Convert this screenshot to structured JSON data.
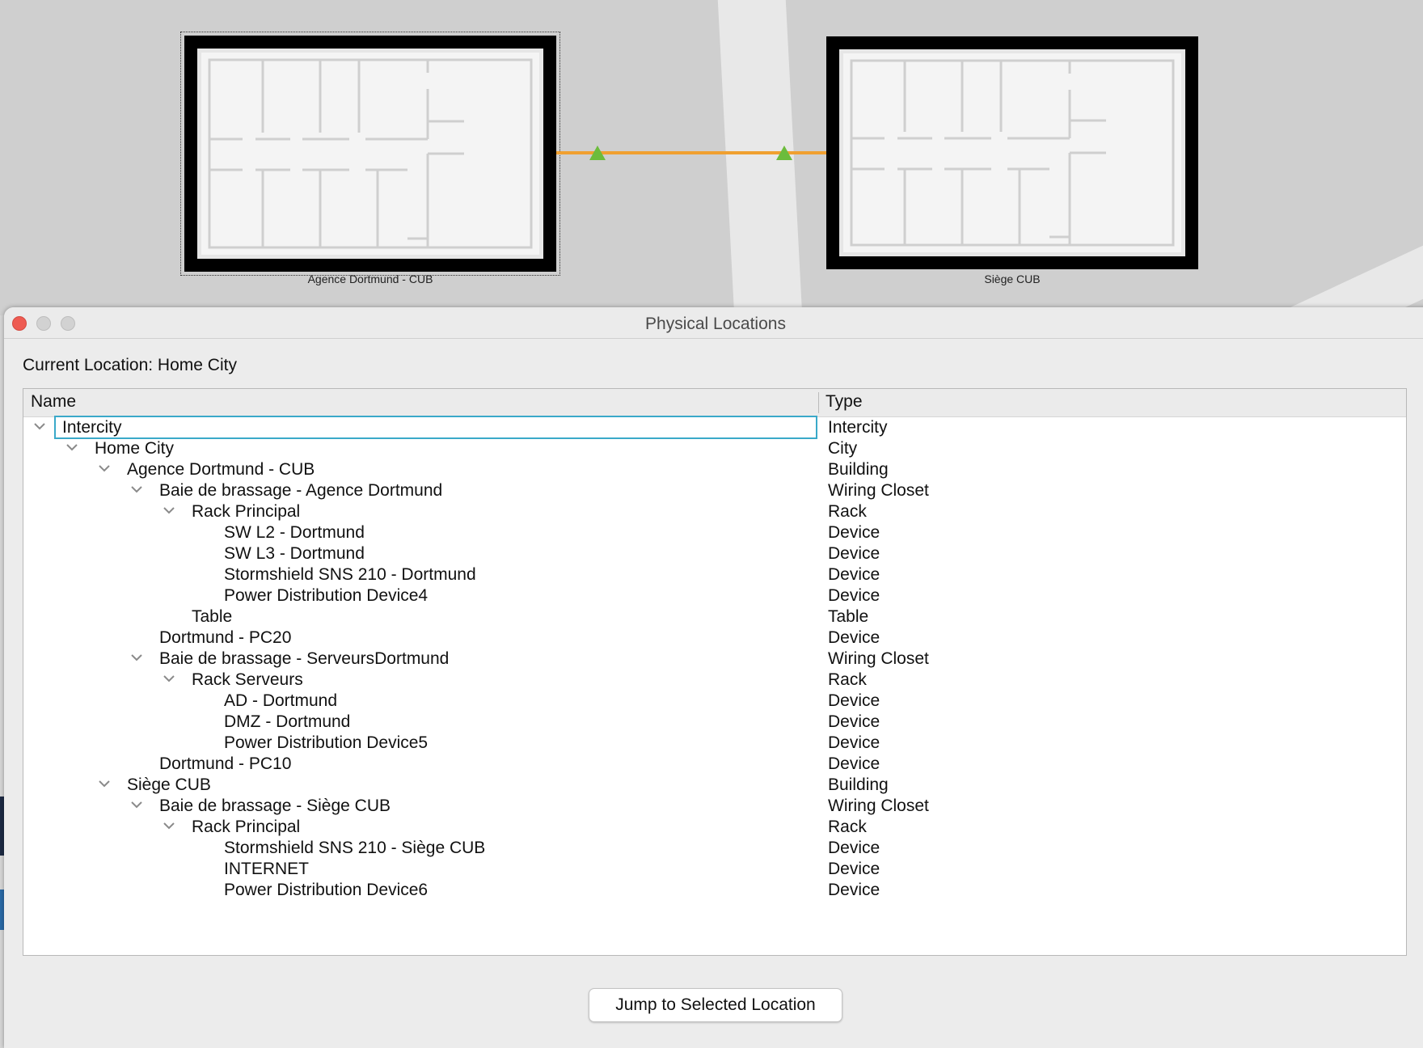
{
  "map": {
    "buildings": [
      {
        "label": "Agence Dortmund - CUB"
      },
      {
        "label": "Siège CUB"
      }
    ],
    "link_color": "#f0a030",
    "link_marker_color": "#6cbc3c"
  },
  "dialog": {
    "title": "Physical Locations",
    "current_location": "Current Location: Home City",
    "columns": {
      "name": "Name",
      "type": "Type"
    },
    "rows": [
      {
        "name": "Intercity",
        "type": "Intercity",
        "level": 0,
        "expanded": true,
        "selected": true
      },
      {
        "name": "Home City",
        "type": "City",
        "level": 1,
        "expanded": true
      },
      {
        "name": "Agence Dortmund - CUB",
        "type": "Building",
        "level": 2,
        "expanded": true
      },
      {
        "name": "Baie de brassage - Agence Dortmund",
        "type": "Wiring Closet",
        "level": 3,
        "expanded": true
      },
      {
        "name": "Rack Principal",
        "type": "Rack",
        "level": 4,
        "expanded": true
      },
      {
        "name": "SW L2 - Dortmund",
        "type": "Device",
        "level": 5
      },
      {
        "name": "SW L3 - Dortmund",
        "type": "Device",
        "level": 5
      },
      {
        "name": "Stormshield SNS 210 - Dortmund",
        "type": "Device",
        "level": 5
      },
      {
        "name": "Power Distribution Device4",
        "type": "Device",
        "level": 5
      },
      {
        "name": "Table",
        "type": "Table",
        "level": 4
      },
      {
        "name": "Dortmund - PC20",
        "type": "Device",
        "level": 3
      },
      {
        "name": "Baie de brassage - ServeursDortmund",
        "type": "Wiring Closet",
        "level": 3,
        "expanded": true
      },
      {
        "name": "Rack Serveurs",
        "type": "Rack",
        "level": 4,
        "expanded": true
      },
      {
        "name": "AD - Dortmund",
        "type": "Device",
        "level": 5
      },
      {
        "name": "DMZ - Dortmund",
        "type": "Device",
        "level": 5
      },
      {
        "name": "Power Distribution Device5",
        "type": "Device",
        "level": 5
      },
      {
        "name": "Dortmund - PC10",
        "type": "Device",
        "level": 3
      },
      {
        "name": "Siège CUB",
        "type": "Building",
        "level": 2,
        "expanded": true
      },
      {
        "name": "Baie de brassage - Siège CUB",
        "type": "Wiring Closet",
        "level": 3,
        "expanded": true
      },
      {
        "name": "Rack Principal",
        "type": "Rack",
        "level": 4,
        "expanded": true
      },
      {
        "name": "Stormshield SNS 210 - Siège CUB",
        "type": "Device",
        "level": 5
      },
      {
        "name": "INTERNET",
        "type": "Device",
        "level": 5
      },
      {
        "name": "Power Distribution Device6",
        "type": "Device",
        "level": 5
      }
    ],
    "jump_button": "Jump to Selected Location"
  }
}
